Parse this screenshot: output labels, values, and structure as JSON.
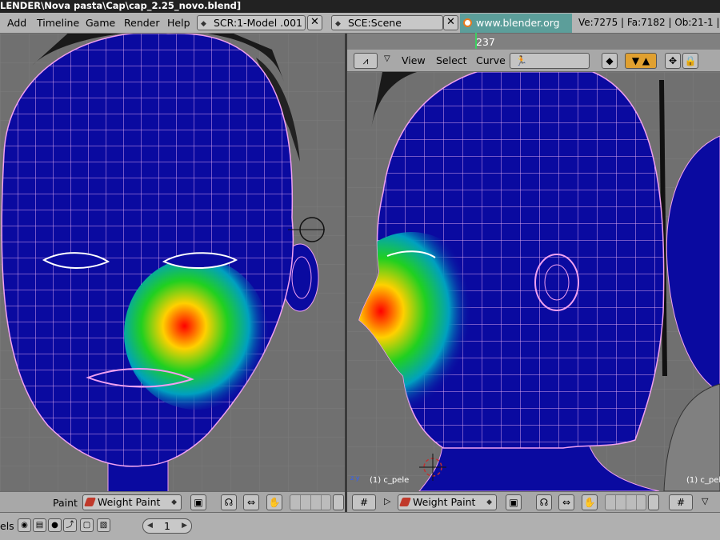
{
  "window": {
    "title": "LENDER\\Nova pasta\\Cap\\cap_2.25_novo.blend]"
  },
  "menu": {
    "items": [
      "Add",
      "Timeline",
      "Game",
      "Render",
      "Help"
    ]
  },
  "screen_field": {
    "value": "SCR:1-Model .001"
  },
  "scene_field": {
    "value": "SCE:Scene"
  },
  "link": {
    "text": "www.blender.org 237"
  },
  "stats": {
    "text": "Ve:7275 | Fa:7182 | Ob:21-1 |"
  },
  "right_header": {
    "view": "View",
    "select": "Select",
    "curve": "Curve"
  },
  "left_view": {
    "object_label": ""
  },
  "right_view": {
    "object_label": "(1) c_pele",
    "object_label2": "(1) c_pel",
    "axis": "z y"
  },
  "left_footer": {
    "mode_label": "Paint",
    "mode_select": "Weight Paint"
  },
  "right_footer": {
    "mode_select": "Weight Paint"
  },
  "bottom": {
    "label": "els",
    "frame": "1"
  },
  "colors": {
    "mesh_blue": "#0a0aa0",
    "wire": "#f0a0f0",
    "link_bg": "#5c9e9a"
  }
}
